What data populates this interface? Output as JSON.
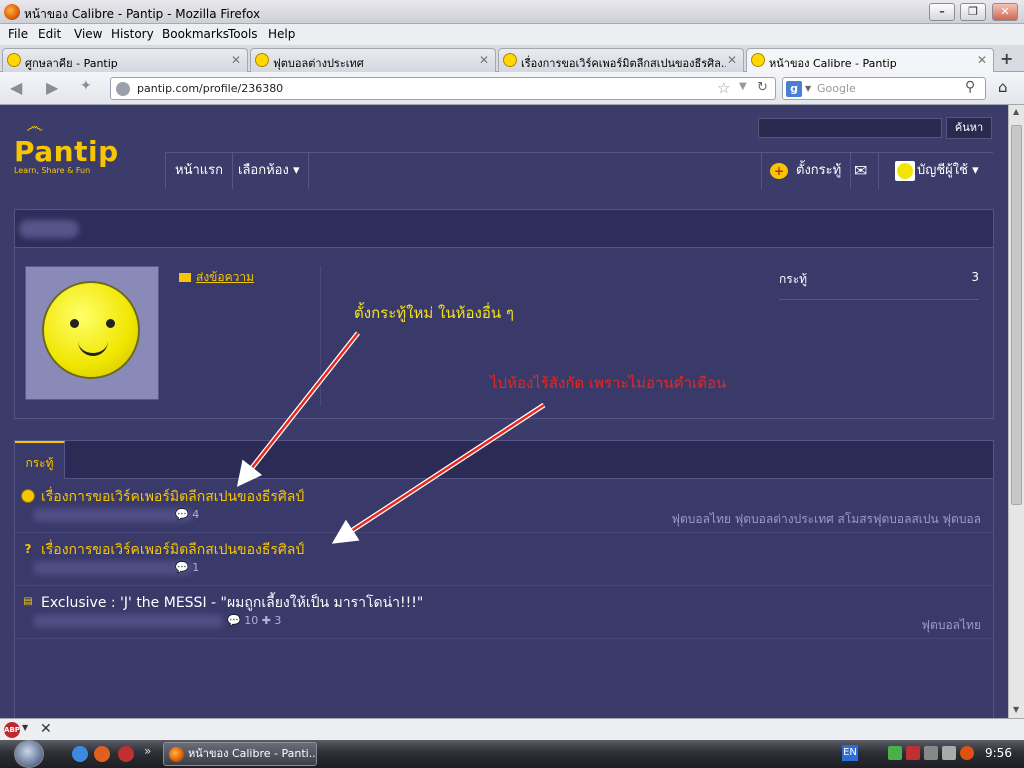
{
  "window": {
    "title": "หน้าของ Calibre - Pantip - Mozilla Firefox"
  },
  "menu": [
    "File",
    "Edit",
    "View",
    "History",
    "Bookmarks",
    "Tools",
    "Help"
  ],
  "tabs": [
    {
      "label": "ศูกษลาคีย - Pantip"
    },
    {
      "label": "ฟุตบอลต่างประเทศ"
    },
    {
      "label": "เรื่องการขอเวิร์คเพอร์มิตลีกสเปนของธีรศิล..."
    },
    {
      "label": "หน้าของ Calibre - Pantip"
    }
  ],
  "nav": {
    "url": "pantip.com/profile/236380",
    "search_placeholder": "Google"
  },
  "site": {
    "logo_text": "Pantip",
    "logo_tagline": "Learn, Share & Fun",
    "search_button": "ค้นหา",
    "nav_items": [
      "หน้าแรก",
      "เลือกห้อง ▾"
    ],
    "post_label": "ตั้งกระทู้",
    "account_label": "บัญชีผู้ใช้ ▾"
  },
  "profile": {
    "message_link": "ส่งข้อความ",
    "stat_label": "กระทู้",
    "stat_value": "3"
  },
  "posts_tab": "กระทู้",
  "posts": [
    {
      "title": "เรื่องการขอเวิร์คเพอร์มิตลีกสเปนของธีรศิลป์",
      "comments": "4",
      "tags": "ฟุตบอลไทย  ฟุตบอลต่างประเทศ  สโมสรฟุตบอลสเปน  ฟุตบอล",
      "icon": "laugh-icon"
    },
    {
      "title": "เรื่องการขอเวิร์คเพอร์มิตลีกสเปนของธีรศิลป์",
      "comments": "1",
      "tags": "",
      "icon": "question-icon"
    },
    {
      "title": "Exclusive : 'J' the MESSI - \"ผมถูกเลี้ยงให้เป็น มาราโดน่า!!!\"",
      "comments": "10",
      "extra": "3",
      "tags": "ฟุตบอลไทย",
      "icon": "news-icon"
    }
  ],
  "annotations": [
    {
      "text": "ตั้งกระทู้ใหม่ ในห้องอื่น ๆ",
      "color": "#f6e51a"
    },
    {
      "text": "ไปห้องไร้สังกัด เพราะไม่อ่านคำเตือน",
      "color": "#e8271e"
    }
  ],
  "taskbar": {
    "task": "หน้าของ Calibre - Panti...",
    "lang": "EN",
    "clock": "9:56"
  },
  "colors": {
    "accent": "#f6c700",
    "bg": "#3c3c6a",
    "annot_red": "#e8271e"
  }
}
